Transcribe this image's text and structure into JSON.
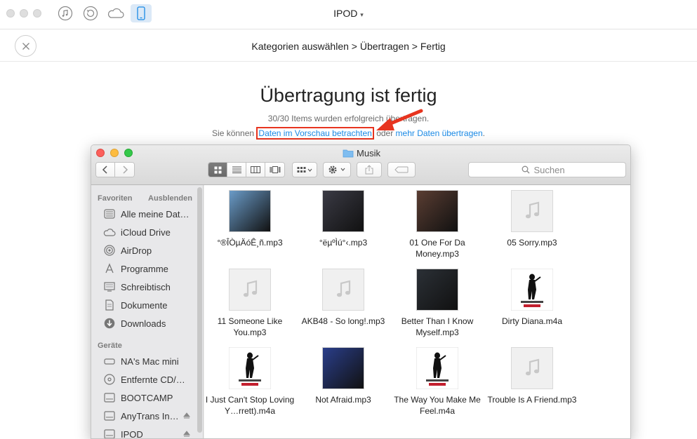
{
  "topbar": {
    "device": "IPOD",
    "icons": [
      "itunes-icon",
      "backup-icon",
      "icloud-icon",
      "device-icon"
    ]
  },
  "breadcrumb": "Kategorien auswählen > Übertragen > Fertig",
  "result": {
    "title": "Übertragung ist fertig",
    "subtitle": "30/30 Items wurden erfolgreich übertragen.",
    "line_prefix": "Sie können ",
    "preview_link": "Daten im Vorschau betrachten",
    "line_middle": " oder ",
    "more_link": "mehr Daten übertragen",
    "line_suffix": "."
  },
  "finder": {
    "title": "Musik",
    "search_placeholder": "Suchen",
    "sidebar": {
      "favorites_header": "Favoriten",
      "hide_label": "Ausblenden",
      "favorites": [
        {
          "label": "Alle meine Dat…",
          "icon": "all-files-icon"
        },
        {
          "label": "iCloud Drive",
          "icon": "icloud-drive-icon"
        },
        {
          "label": "AirDrop",
          "icon": "airdrop-icon"
        },
        {
          "label": "Programme",
          "icon": "applications-icon"
        },
        {
          "label": "Schreibtisch",
          "icon": "desktop-icon"
        },
        {
          "label": "Dokumente",
          "icon": "documents-icon"
        },
        {
          "label": "Downloads",
          "icon": "downloads-icon"
        }
      ],
      "devices_header": "Geräte",
      "devices": [
        {
          "label": "NA's Mac mini",
          "icon": "mac-mini-icon"
        },
        {
          "label": "Entfernte CD/…",
          "icon": "remote-disc-icon"
        },
        {
          "label": "BOOTCAMP",
          "icon": "disk-icon"
        },
        {
          "label": "AnyTrans In…",
          "icon": "disk-icon"
        },
        {
          "label": "IPOD",
          "icon": "disk-icon"
        }
      ]
    },
    "files": [
      {
        "name": "°®ÎÒµÄóÊ¸ñ.mp3",
        "art": "album-1",
        "color": "#6a9bc8"
      },
      {
        "name": "°ëµºÌú°‹.mp3",
        "art": "album-2",
        "color": "#3a3a44"
      },
      {
        "name": "01 One For Da Money.mp3",
        "art": "album-3",
        "color": "#5a3d32"
      },
      {
        "name": "05 Sorry.mp3",
        "art": "generic"
      },
      {
        "name": "11 Someone Like You.mp3",
        "art": "generic"
      },
      {
        "name": "AKB48 - So long!.mp3",
        "art": "generic"
      },
      {
        "name": "Better Than I Know Myself.mp3",
        "art": "album-4",
        "color": "#2b3036"
      },
      {
        "name": "Dirty Diana.m4a",
        "art": "mj"
      },
      {
        "name": "I Just Can't Stop Loving Y…rrett).m4a",
        "art": "mj"
      },
      {
        "name": "Not Afraid.mp3",
        "art": "album-5",
        "color": "#2a3e8a"
      },
      {
        "name": "The Way You Make Me Feel.m4a",
        "art": "mj"
      },
      {
        "name": "Trouble Is A Friend.mp3",
        "art": "generic"
      }
    ]
  }
}
